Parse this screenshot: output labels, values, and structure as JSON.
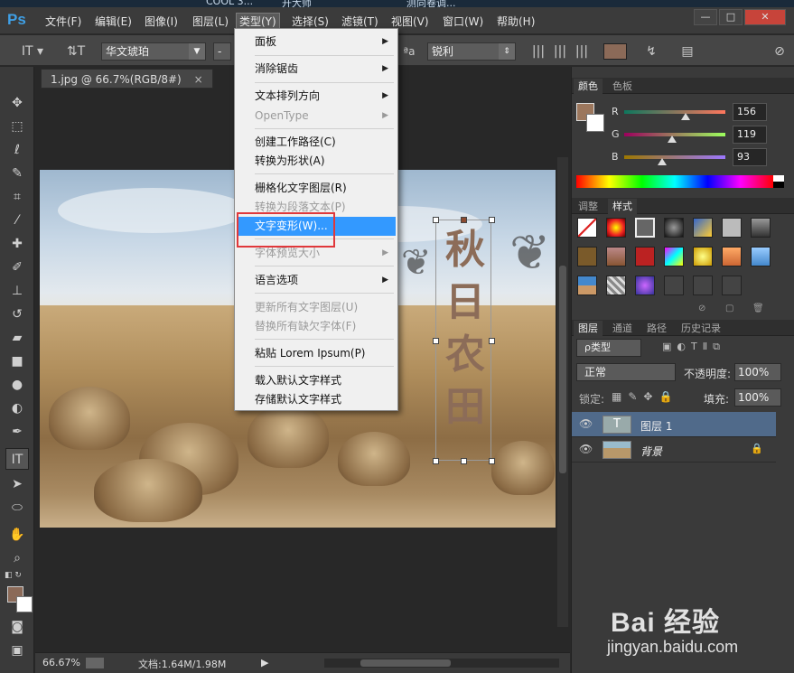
{
  "taskbar": {
    "item1": "COOL 3...",
    "item2": "开大师",
    "item3": "测向卷调..."
  },
  "app": {
    "logo": "Ps"
  },
  "menubar": {
    "items": [
      "文件(F)",
      "编辑(E)",
      "图像(I)",
      "图层(L)",
      "类型(Y)",
      "选择(S)",
      "滤镜(T)",
      "视图(V)",
      "窗口(W)",
      "帮助(H)"
    ],
    "active": "类型(Y)"
  },
  "window_controls": {
    "minimize": "—",
    "maximize": "□",
    "close": "✕"
  },
  "options_bar": {
    "font_family": "华文琥珀",
    "font_style": "-",
    "aa_label": "ªa",
    "antialias": "锐利",
    "text_color": "#8b6a58"
  },
  "document": {
    "tab_title": "1.jpg @ 66.7%(RGB/8#)",
    "tab_close": "×",
    "vertical_text": "秋日农田"
  },
  "status": {
    "zoom": "66.67%",
    "doc_size": "文档:1.64M/1.98M"
  },
  "color_panel": {
    "tabs": [
      "颜色",
      "色板"
    ],
    "active_tab": "颜色",
    "channels": [
      {
        "label": "R",
        "value": "156"
      },
      {
        "label": "G",
        "value": "119"
      },
      {
        "label": "B",
        "value": "93"
      }
    ],
    "foreground": "#9c775d"
  },
  "styles_panel": {
    "tabs": [
      "调整",
      "样式"
    ],
    "active_tab": "样式"
  },
  "layers_panel": {
    "tabs": [
      "图层",
      "通道",
      "路径",
      "历史记录"
    ],
    "active_tab": "图层",
    "filter": "ρ类型",
    "blend_mode": "正常",
    "opacity_label": "不透明度:",
    "opacity_value": "100%",
    "lock_label": "锁定:",
    "fill_label": "填充:",
    "fill_value": "100%",
    "layers": [
      {
        "name": "图层 1",
        "thumb": "T",
        "selected": true
      },
      {
        "name": "背景",
        "thumb": "",
        "selected": false
      }
    ]
  },
  "type_menu": {
    "items": [
      {
        "label": "面板",
        "submenu": true,
        "disabled": false
      },
      {
        "label": "消除锯齿",
        "submenu": true,
        "disabled": false
      },
      {
        "label": "文本排列方向",
        "submenu": true,
        "disabled": false
      },
      {
        "label": "OpenType",
        "submenu": true,
        "disabled": true
      },
      {
        "label": "创建工作路径(C)",
        "submenu": false,
        "disabled": false
      },
      {
        "label": "转换为形状(A)",
        "submenu": false,
        "disabled": false
      },
      {
        "label": "栅格化文字图层(R)",
        "submenu": false,
        "disabled": false
      },
      {
        "label": "转换为段落文本(P)",
        "submenu": false,
        "disabled": true
      },
      {
        "label": "文字变形(W)...",
        "submenu": false,
        "disabled": false,
        "highlighted": true
      },
      {
        "label": "字体预览大小",
        "submenu": true,
        "disabled": true
      },
      {
        "label": "语言选项",
        "submenu": true,
        "disabled": false
      },
      {
        "label": "更新所有文字图层(U)",
        "submenu": false,
        "disabled": true
      },
      {
        "label": "替换所有缺欠字体(F)",
        "submenu": false,
        "disabled": true
      },
      {
        "label": "粘贴 Lorem Ipsum(P)",
        "submenu": false,
        "disabled": false
      },
      {
        "label": "载入默认文字样式",
        "submenu": false,
        "disabled": false
      },
      {
        "label": "存储默认文字样式",
        "submenu": false,
        "disabled": false
      }
    ]
  },
  "watermark": {
    "brand": "Bai 经验",
    "site": "jingyan.baidu.com"
  }
}
